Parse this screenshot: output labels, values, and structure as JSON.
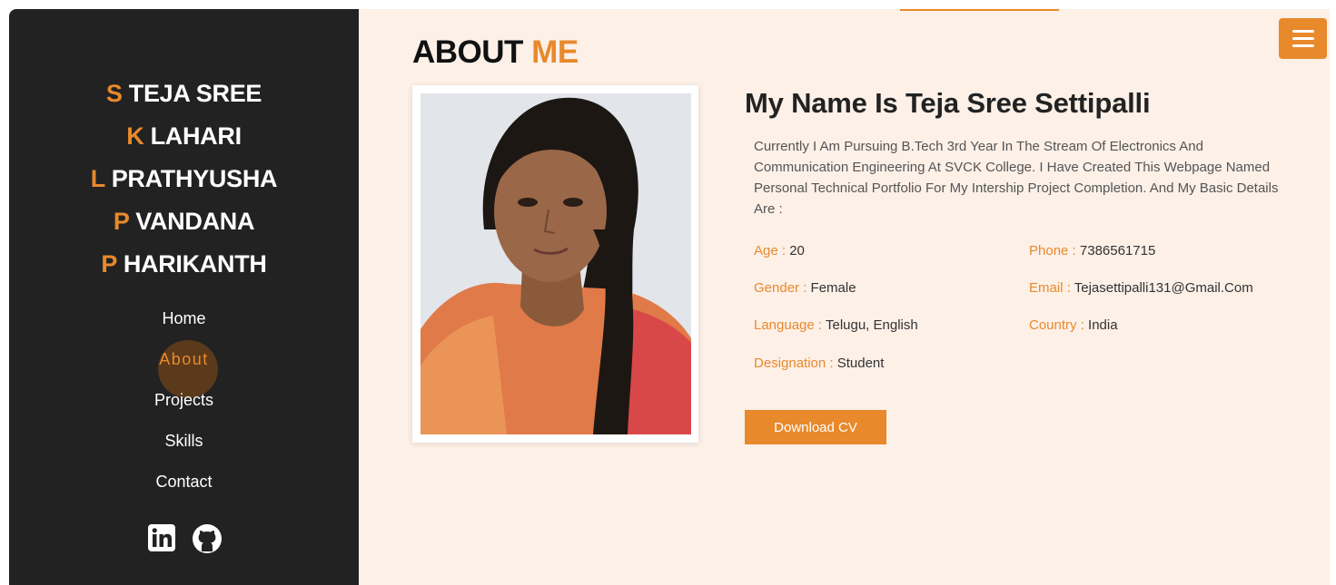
{
  "team": [
    {
      "initial": "S",
      "name": "TEJA SREE"
    },
    {
      "initial": "K",
      "name": "LAHARI"
    },
    {
      "initial": "L",
      "name": "PRATHYUSHA"
    },
    {
      "initial": "P",
      "name": "VANDANA"
    },
    {
      "initial": "P",
      "name": "HARIKANTH"
    }
  ],
  "nav": {
    "items": [
      {
        "label": "Home"
      },
      {
        "label": "About",
        "active": true
      },
      {
        "label": "Projects"
      },
      {
        "label": "Skills"
      },
      {
        "label": "Contact"
      }
    ]
  },
  "socials": [
    {
      "icon": "linkedin-icon"
    },
    {
      "icon": "github-icon"
    }
  ],
  "header": {
    "title_main": "ABOUT",
    "title_accent": "ME",
    "menu_icon": "hamburger-icon"
  },
  "about": {
    "heading": "My Name Is Teja Sree Settipalli",
    "intro": "Currently I Am Pursuing B.Tech 3rd Year In The Stream Of Electronics And Communication Engineering At SVCK College. I Have Created This Webpage Named Personal Technical Portfolio For My Intership Project Completion. And My Basic Details Are :",
    "details": {
      "age": {
        "label": "Age :",
        "value": "20"
      },
      "phone": {
        "label": "Phone :",
        "value": "7386561715"
      },
      "gender": {
        "label": "Gender :",
        "value": "Female"
      },
      "email": {
        "label": "Email :",
        "value": "Tejasettipalli131@Gmail.Com"
      },
      "language": {
        "label": "Language :",
        "value": "Telugu, English"
      },
      "country": {
        "label": "Country :",
        "value": "India"
      },
      "designation": {
        "label": "Designation :",
        "value": "Student"
      }
    },
    "button_label": "Download CV"
  },
  "colors": {
    "accent": "#e8892b",
    "sidebar": "#222222",
    "background": "#fcf0e7"
  }
}
